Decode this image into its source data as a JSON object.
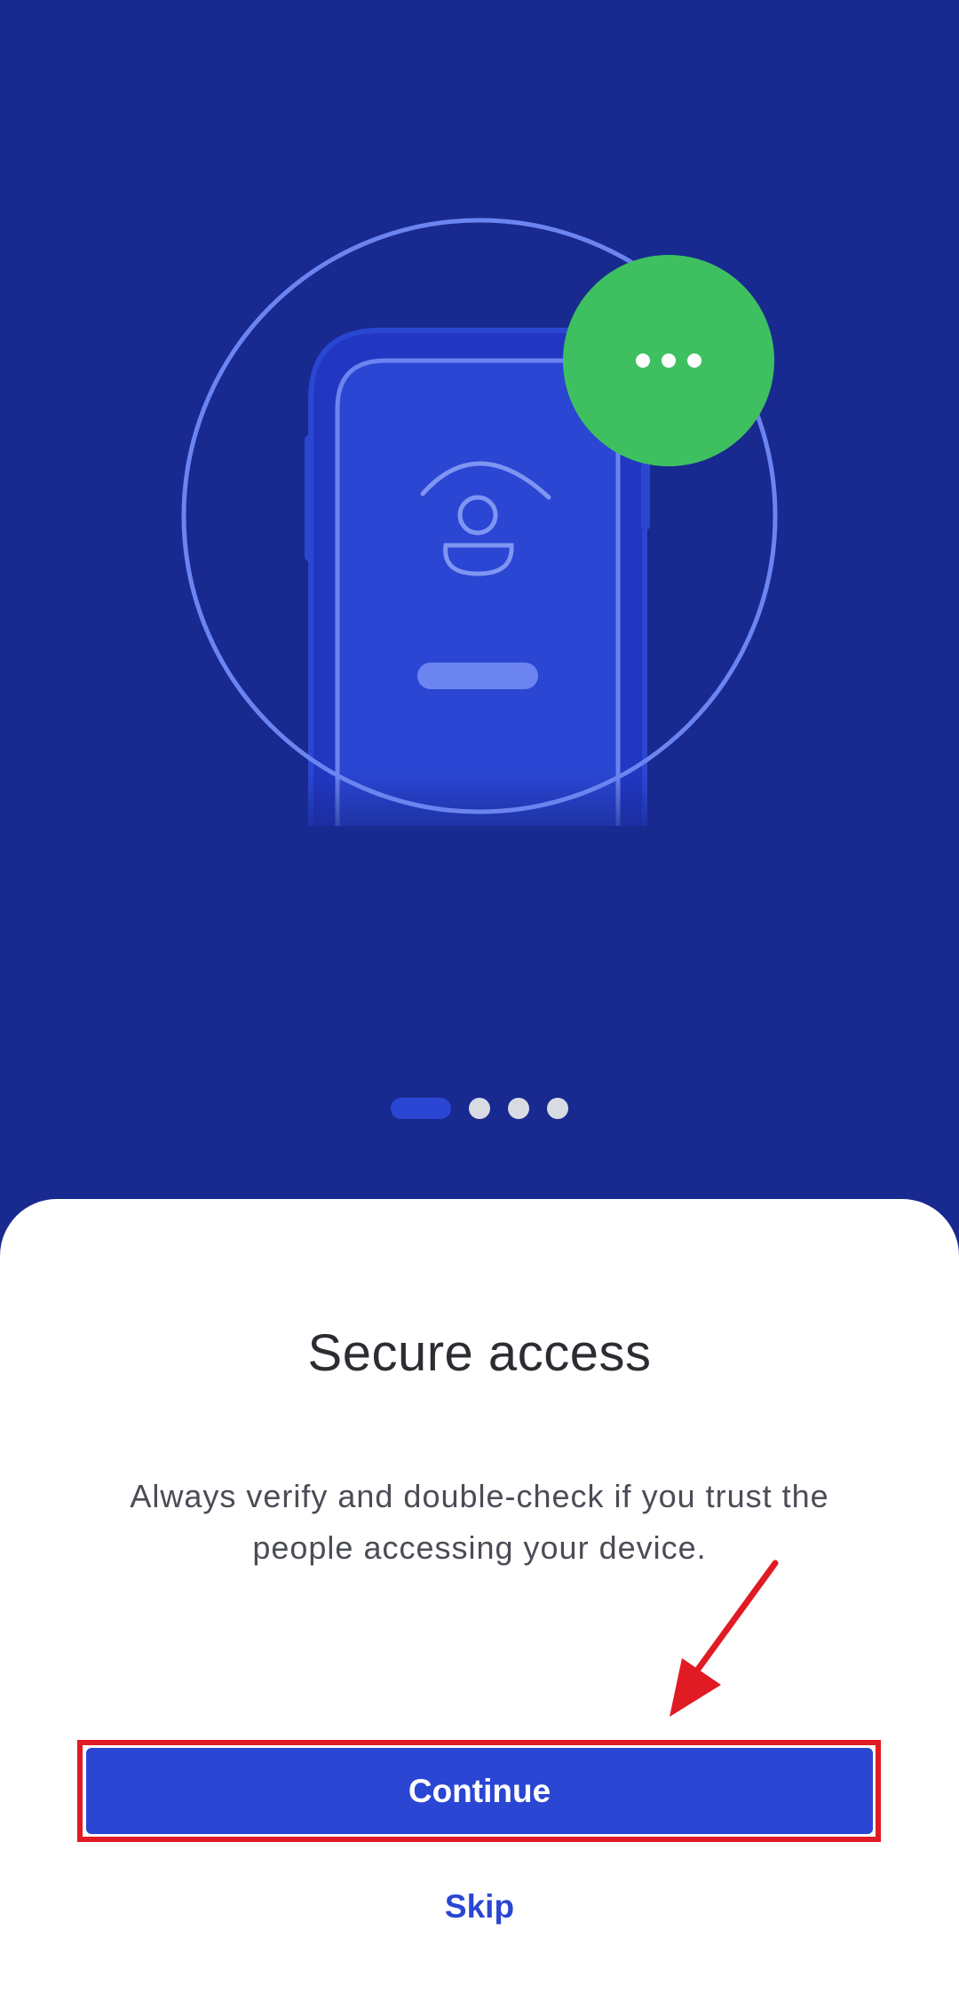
{
  "onboarding": {
    "title": "Secure access",
    "description": "Always verify and double-check if you trust the people accessing your device.",
    "continue_label": "Continue",
    "skip_label": "Skip",
    "pager": {
      "total_pages": 4,
      "current_page": 1
    }
  },
  "illustration": {
    "icons": [
      "phone-icon",
      "user-icon",
      "more-dots-icon"
    ]
  },
  "colors": {
    "hero_background": "#18298F",
    "accent": "#2A46D3",
    "badge_green": "#3FC060",
    "annotation_red": "#E01B24"
  }
}
